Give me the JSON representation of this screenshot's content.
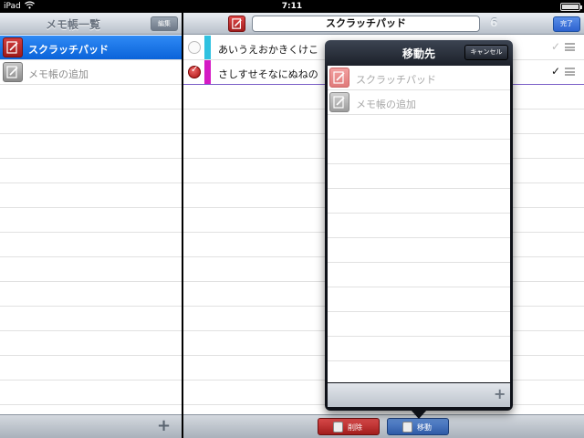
{
  "status_bar": {
    "device": "iPad",
    "time": "7:11",
    "battery_level": 0.9
  },
  "left_pane": {
    "title": "メモ帳一覧",
    "edit_label": "編集",
    "items": [
      {
        "label": "スクラッチパッド",
        "icon": "notepad-red-icon",
        "selected": true
      },
      {
        "label": "メモ帳の追加",
        "icon": "notepad-gray-icon",
        "selected": false
      }
    ],
    "add_glyph": "+"
  },
  "right_pane": {
    "title": "スクラッチパッド",
    "count": "6",
    "done_label": "完了",
    "tasks": [
      {
        "text": "あいうえおかきくけこ",
        "checked": false,
        "color": "#2fc1e0"
      },
      {
        "text": "さしすせそなにぬねの",
        "checked": true,
        "color": "#d41ac4"
      }
    ],
    "delete_label": "削除",
    "move_label": "移動"
  },
  "popover": {
    "title": "移動先",
    "cancel_label": "キャンセル",
    "items": [
      {
        "label": "スクラッチパッド",
        "icon": "notepad-red-icon"
      },
      {
        "label": "メモ帳の追加",
        "icon": "notepad-gray-icon"
      }
    ],
    "add_glyph": "+"
  },
  "colors": {
    "accent_blue": "#0a63d9",
    "brand_red": "#a11c1c",
    "popover_dark": "#0e1118"
  }
}
